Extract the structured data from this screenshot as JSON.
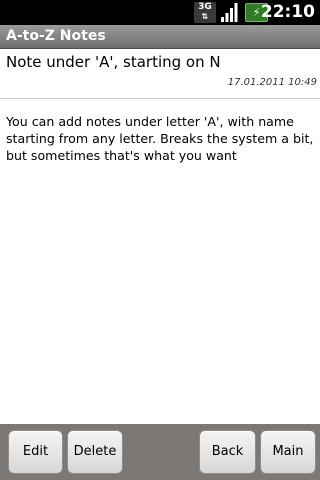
{
  "status_bar": {
    "network_type": "3G",
    "network_icon": "data-arrows-icon",
    "signal_icon": "signal-strength-icon",
    "battery_icon": "battery-charging-icon",
    "clock": "22:10"
  },
  "title_bar": {
    "title": "A-to-Z Notes"
  },
  "note": {
    "title": "Note under 'A', starting on N",
    "date": "17.01.2011 10:49",
    "body": "You can add notes under letter 'A', with name starting from any letter. Breaks the system a bit, but sometimes that's what you want"
  },
  "buttons": {
    "edit": "Edit",
    "delete": "Delete",
    "back": "Back",
    "main": "Main"
  },
  "colors": {
    "title_bar": "#7f7f7f",
    "button_bar": "#7d7874",
    "battery": "#2f7d23"
  }
}
